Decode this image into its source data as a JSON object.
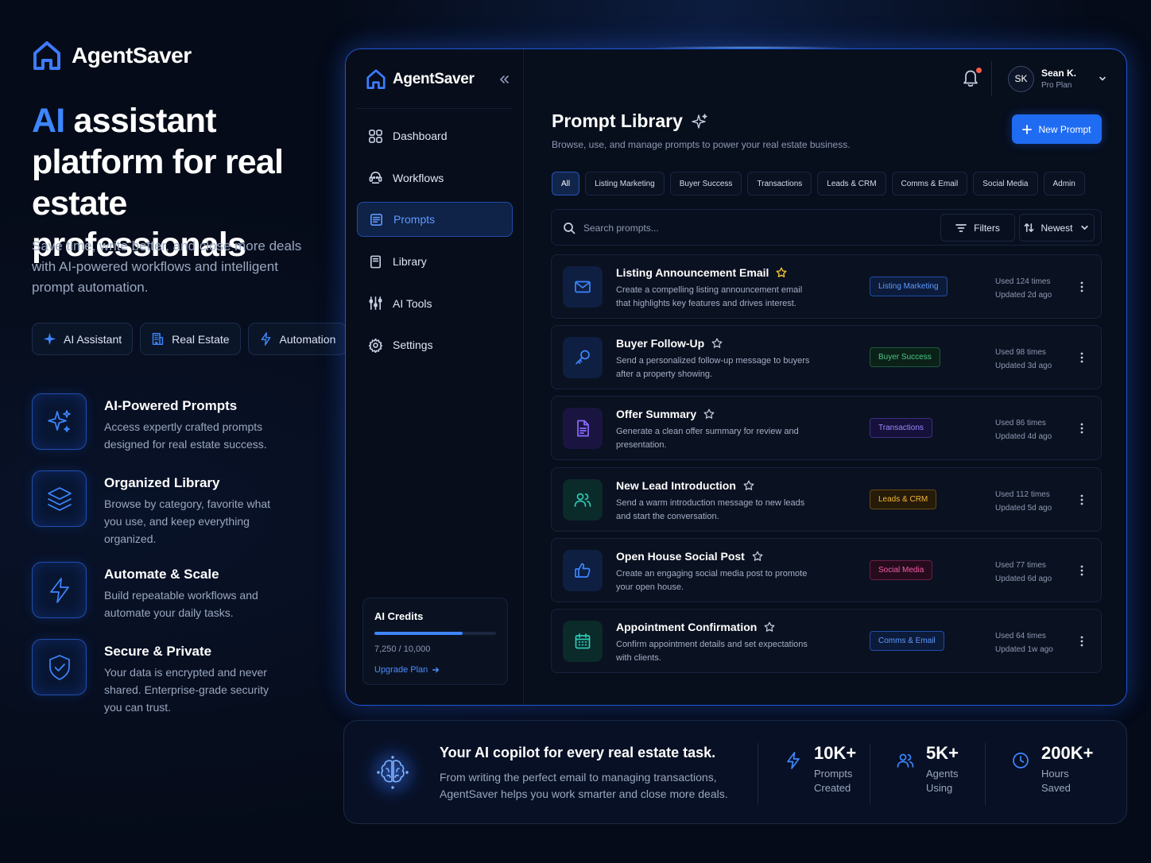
{
  "brand": {
    "name": "AgentSaver"
  },
  "hero": {
    "title_accent": "AI",
    "title_rest": " assistant platform for real estate professionals",
    "subtitle": "Save time, write better, and close more deals with AI-powered workflows and intelligent prompt automation."
  },
  "chips": [
    {
      "label": "AI Assistant",
      "icon": "sparkle-icon"
    },
    {
      "label": "Real Estate",
      "icon": "building-icon"
    },
    {
      "label": "Automation",
      "icon": "lightning-icon"
    }
  ],
  "features": [
    {
      "title": "AI-Powered Prompts",
      "desc": "Access expertly crafted prompts designed for real estate success.",
      "icon": "sparkles-icon"
    },
    {
      "title": "Organized Library",
      "desc": "Browse by category, favorite what you use, and keep everything organized.",
      "icon": "layers-icon"
    },
    {
      "title": "Automate & Scale",
      "desc": "Build repeatable workflows and automate your daily tasks.",
      "icon": "lightning-icon"
    },
    {
      "title": "Secure & Private",
      "desc": "Your data is encrypted and never shared. Enterprise-grade security you can trust.",
      "icon": "shield-check-icon"
    }
  ],
  "app": {
    "brand": "AgentSaver",
    "nav": [
      {
        "label": "Dashboard",
        "icon": "grid-icon",
        "active": false
      },
      {
        "label": "Workflows",
        "icon": "robot-icon",
        "active": false
      },
      {
        "label": "Prompts",
        "icon": "form-icon",
        "active": true
      },
      {
        "label": "Library",
        "icon": "book-icon",
        "active": false
      },
      {
        "label": "AI Tools",
        "icon": "sliders-icon",
        "active": false
      },
      {
        "label": "Settings",
        "icon": "gear-icon",
        "active": false
      }
    ],
    "credits": {
      "title": "AI Credits",
      "value": "7,250 / 10,000",
      "used_fraction": 0.725,
      "upgrade": "Upgrade Plan"
    },
    "user": {
      "initials": "SK",
      "name": "Sean K.",
      "plan": "Pro Plan"
    },
    "page": {
      "title": "Prompt Library",
      "subtitle": "Browse, use, and manage prompts to power your real estate business.",
      "new_button": "New Prompt"
    },
    "tabs": [
      "All",
      "Listing Marketing",
      "Buyer Success",
      "Transactions",
      "Leads & CRM",
      "Comms & Email",
      "Social Media",
      "Admin"
    ],
    "search": {
      "placeholder": "Search prompts...",
      "filters": "Filters",
      "sort": "Newest"
    },
    "prompts": [
      {
        "title": "Listing Announcement Email",
        "desc": "Create a compelling listing announcement email that highlights key features and drives interest.",
        "tag": "Listing Marketing",
        "used": "Used 124 times",
        "updated": "Updated 2d ago",
        "favorite": true,
        "icon": "mail-icon",
        "color": "#3d86ff"
      },
      {
        "title": "Buyer Follow-Up",
        "desc": "Send a personalized follow-up message to buyers after a property showing.",
        "tag": "Buyer Success",
        "used": "Used 98 times",
        "updated": "Updated 3d ago",
        "favorite": false,
        "icon": "key-icon",
        "color": "#3d86ff"
      },
      {
        "title": "Offer Summary",
        "desc": "Generate a clean offer summary for review and presentation.",
        "tag": "Transactions",
        "used": "Used 86 times",
        "updated": "Updated 4d ago",
        "favorite": false,
        "icon": "document-icon",
        "color": "#8a6bff"
      },
      {
        "title": "New Lead Introduction",
        "desc": "Send a warm introduction message to new leads and start the conversation.",
        "tag": "Leads & CRM",
        "used": "Used 112 times",
        "updated": "Updated 5d ago",
        "favorite": false,
        "icon": "users-icon",
        "color": "#2fc7b4"
      },
      {
        "title": "Open House Social Post",
        "desc": "Create an engaging social media post to promote your open house.",
        "tag": "Social Media",
        "used": "Used 77 times",
        "updated": "Updated 6d ago",
        "favorite": false,
        "icon": "thumbs-up-icon",
        "color": "#3d86ff"
      },
      {
        "title": "Appointment Confirmation",
        "desc": "Confirm appointment details and set expectations with clients.",
        "tag": "Comms & Email",
        "used": "Used 64 times",
        "updated": "Updated 1w ago",
        "favorite": false,
        "icon": "calendar-icon",
        "color": "#2fc7b4"
      }
    ]
  },
  "banner": {
    "title": "Your AI copilot for every real estate task.",
    "subtitle": "From writing the perfect email to managing transactions, AgentSaver helps you work smarter and close more deals.",
    "stats": [
      {
        "value": "10K+",
        "label": "Prompts Created",
        "icon": "lightning-icon"
      },
      {
        "value": "5K+",
        "label": "Agents Using",
        "icon": "users-icon"
      },
      {
        "value": "200K+",
        "label": "Hours Saved",
        "icon": "clock-icon"
      }
    ]
  }
}
